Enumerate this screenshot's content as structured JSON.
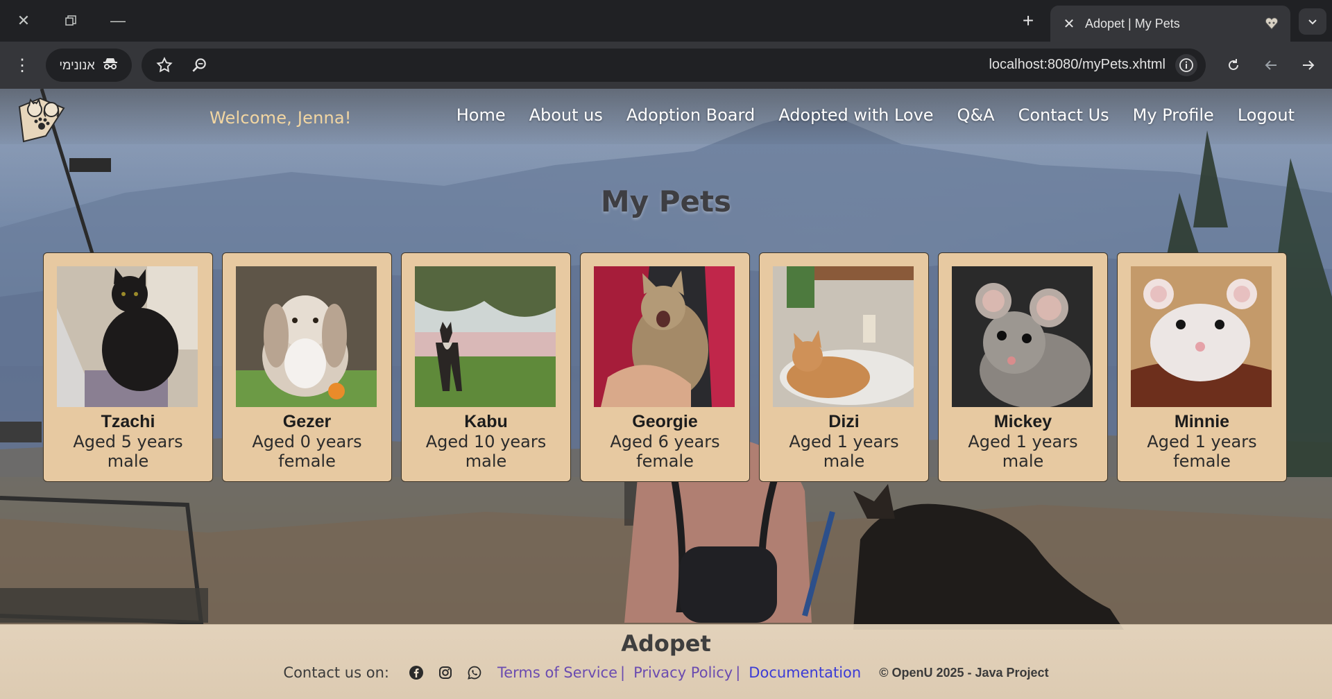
{
  "browser": {
    "tab_title": "Adopet | My Pets",
    "incognito_label": "אנונימי",
    "url": "localhost:8080/myPets.xhtml"
  },
  "header": {
    "welcome": "Welcome, Jenna!",
    "nav": [
      {
        "label": "Home"
      },
      {
        "label": "About us"
      },
      {
        "label": "Adoption Board"
      },
      {
        "label": "Adopted with Love"
      },
      {
        "label": "Q&A"
      },
      {
        "label": "Contact Us"
      },
      {
        "label": "My Profile"
      },
      {
        "label": "Logout"
      }
    ]
  },
  "main": {
    "title": "My Pets",
    "pets": [
      {
        "name": "Tzachi",
        "age": "Aged 5 years",
        "gender": "male",
        "photo_icon": "black-cat-photo"
      },
      {
        "name": "Gezer",
        "age": "Aged 0 years",
        "gender": "female",
        "photo_icon": "rabbit-photo"
      },
      {
        "name": "Kabu",
        "age": "Aged 10 years",
        "gender": "male",
        "photo_icon": "dog-photo"
      },
      {
        "name": "Georgie",
        "age": "Aged 6 years",
        "gender": "female",
        "photo_icon": "tabby-cat-photo"
      },
      {
        "name": "Dizi",
        "age": "Aged 1 years",
        "gender": "male",
        "photo_icon": "cat-in-sink-photo"
      },
      {
        "name": "Mickey",
        "age": "Aged 1 years",
        "gender": "male",
        "photo_icon": "mouse-photo"
      },
      {
        "name": "Minnie",
        "age": "Aged 1 years",
        "gender": "female",
        "photo_icon": "white-mouse-photo"
      }
    ]
  },
  "footer": {
    "title": "Adopet",
    "contact_label": "Contact us on:",
    "links": {
      "terms": "Terms of Service",
      "privacy": "Privacy Policy",
      "docs": "Documentation",
      "separator": "|"
    },
    "copyright": "© OpenU 2025 - Java Project"
  },
  "colors": {
    "card_bg": "#e7c9a1",
    "welcome": "#f2d6a2",
    "link_purple": "#6a4bb0",
    "link_blue": "#3b3bd6"
  }
}
